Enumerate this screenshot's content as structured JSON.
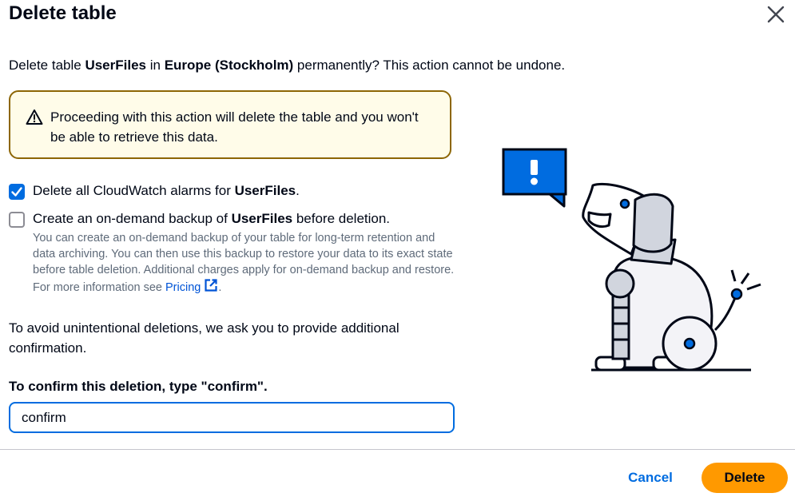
{
  "modal": {
    "title": "Delete table",
    "close_icon": "close-icon"
  },
  "description": {
    "prefix": "Delete table ",
    "table_name": "UserFiles",
    "mid": " in ",
    "region": "Europe (Stockholm)",
    "suffix": " permanently? This action cannot be undone."
  },
  "warning": {
    "icon": "warning-icon",
    "text": "Proceeding with this action will delete the table and you won't be able to retrieve this data."
  },
  "options": {
    "alarms": {
      "checked": true,
      "prefix": "Delete all CloudWatch alarms for ",
      "table_name": "UserFiles",
      "suffix": "."
    },
    "backup": {
      "checked": false,
      "prefix": "Create an on-demand backup of ",
      "table_name": "UserFiles",
      "suffix": " before deletion.",
      "help_text": "You can create an on-demand backup of your table for long-term retention and data archiving. You can then use this backup to restore your data to its exact state before table deletion. Additional charges apply for on-demand backup and restore. For more information see ",
      "link_text": "Pricing",
      "help_end": "."
    }
  },
  "confirmation": {
    "note": "To avoid unintentional deletions, we ask you to provide additional confirmation.",
    "label": "To confirm this deletion, type \"confirm\".",
    "value": "confirm"
  },
  "footer": {
    "cancel_label": "Cancel",
    "delete_label": "Delete"
  },
  "colors": {
    "primary": "#006ce0",
    "delete_button": "#ff9900",
    "warning_border": "#8d6605",
    "warning_bg": "#fffce9"
  }
}
